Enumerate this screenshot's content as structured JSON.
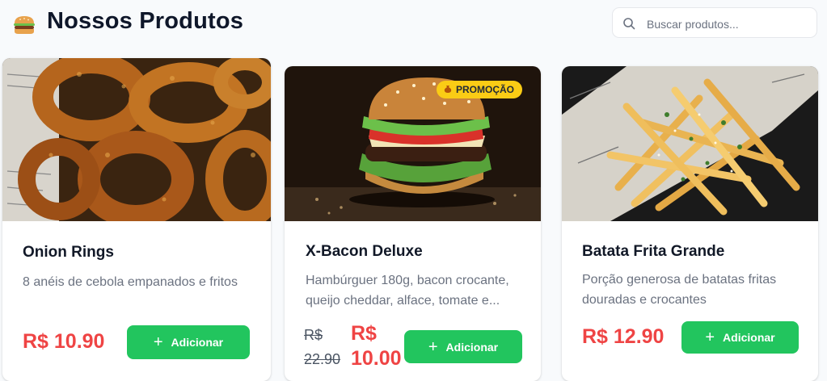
{
  "header": {
    "logo_icon": "burger-icon",
    "title": "Nossos Produtos"
  },
  "search": {
    "icon": "search-icon",
    "placeholder": "Buscar produtos...",
    "value": ""
  },
  "products": [
    {
      "name": "Onion Rings",
      "description": "8 anéis de cebola empanados e fritos",
      "price": "R$ 10.90",
      "button_label": "Adicionar",
      "image": "onion-rings-photo"
    },
    {
      "name": "X-Bacon Deluxe",
      "description": "Hambúrguer 180g, bacon crocante, queijo cheddar, alface, tomate e...",
      "old_price": "R$ 22.90",
      "price": "R$ 10.00",
      "badge": "PROMOÇÃO",
      "badge_icon": "money-bag-icon",
      "button_label": "Adicionar",
      "image": "burger-photo"
    },
    {
      "name": "Batata Frita Grande",
      "description": "Porção generosa de batatas fritas douradas e crocantes",
      "price": "R$ 12.90",
      "button_label": "Adicionar",
      "image": "french-fries-photo"
    }
  ],
  "colors": {
    "accent_green": "#22c55e",
    "price_red": "#ef4444",
    "badge_yellow": "#facc15"
  }
}
